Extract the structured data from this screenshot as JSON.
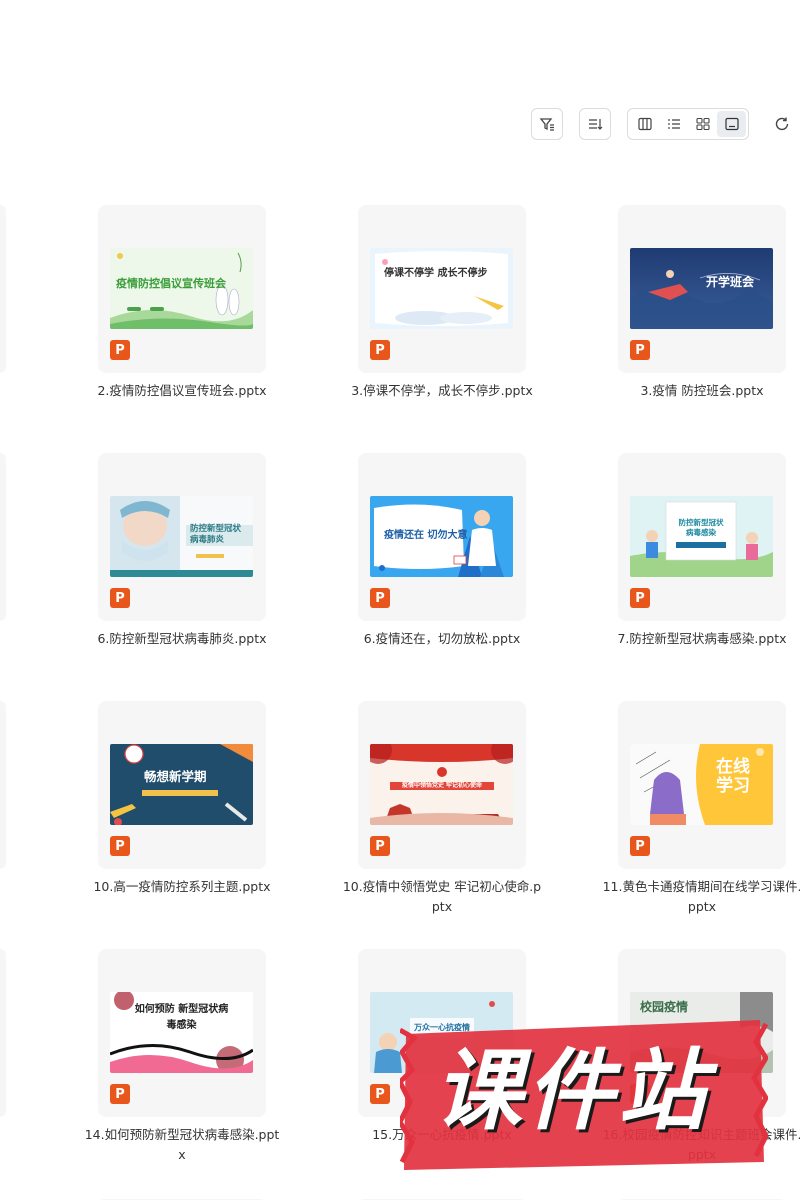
{
  "toolbar": {
    "filter_icon": "filter-icon",
    "sort_icon": "sort-icon",
    "views": [
      "columns-view-icon",
      "list-view-icon",
      "grid-view-icon",
      "thumbnail-view-icon"
    ],
    "active_view": 3,
    "refresh_icon": "refresh-icon"
  },
  "files": [
    {
      "name": "2.疫情防控倡议宣传班会.pptx",
      "thumb_text": "疫情防控倡议宣传班会",
      "type_badge": "P"
    },
    {
      "name": "3.停课不停学，成长不停步.pptx",
      "thumb_text": "停课不停学 成长不停步",
      "type_badge": "P"
    },
    {
      "name": "3.疫情 防控班会.pptx",
      "thumb_text": "开学班会",
      "type_badge": "P"
    },
    {
      "name": "6.防控新型冠状病毒肺炎.pptx",
      "thumb_text": "防控新型冠状病毒肺炎",
      "type_badge": "P"
    },
    {
      "name": "6.疫情还在，切勿放松.pptx",
      "thumb_text": "疫情还在 切勿大意",
      "type_badge": "P"
    },
    {
      "name": "7.防控新型冠状病毒感染.pptx",
      "thumb_text": "防控新型冠状病毒感染",
      "type_badge": "P"
    },
    {
      "name": "10.高一疫情防控系列主题.pptx",
      "thumb_text": "畅想新学期",
      "type_badge": "P"
    },
    {
      "name": "10.疫情中领悟党史 牢记初心使命.pptx",
      "thumb_text": "疫情中领悟党史 牢记初心使命",
      "type_badge": "P"
    },
    {
      "name": "11.黄色卡通疫情期间在线学习课件.pptx",
      "thumb_text": "在线学习",
      "type_badge": "P"
    },
    {
      "name": "14.如何预防新型冠状病毒感染.pptx",
      "thumb_text": "如何预防 新型冠状病毒感染",
      "type_badge": "P"
    },
    {
      "name": "15.万众一心抗疫情.pptx",
      "thumb_text": "万众一心抗疫情",
      "type_badge": "P"
    },
    {
      "name": "16.校园疫情防控知识主题班会课件.pptx",
      "thumb_text": "校园疫情",
      "type_badge": "P"
    }
  ],
  "watermark": {
    "text": "课件站",
    "color": "#e2323f"
  }
}
